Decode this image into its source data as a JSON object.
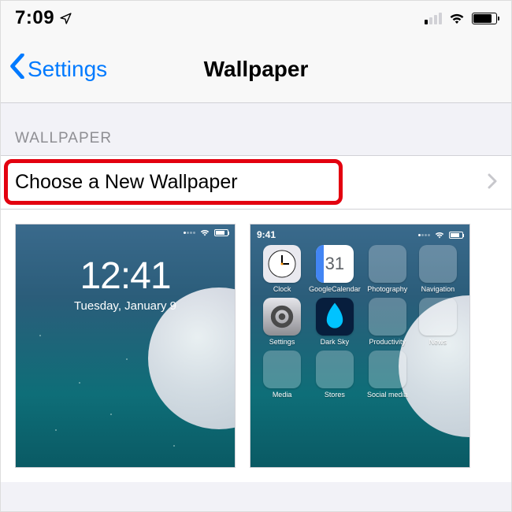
{
  "statusbar": {
    "time": "7:09"
  },
  "nav": {
    "back_label": "Settings",
    "title": "Wallpaper"
  },
  "section": {
    "header": "WALLPAPER",
    "choose_label": "Choose a New Wallpaper"
  },
  "lock_preview": {
    "time": "12:41",
    "date": "Tuesday, January 9"
  },
  "home_preview": {
    "time": "9:41",
    "apps": [
      {
        "name": "Clock"
      },
      {
        "name": "GoogleCalendar",
        "day": "31"
      },
      {
        "name": "Photography",
        "folder": true
      },
      {
        "name": "Navigation",
        "folder": true
      },
      {
        "name": "Settings"
      },
      {
        "name": "Dark Sky"
      },
      {
        "name": "Productivity",
        "folder": true
      },
      {
        "name": "News",
        "folder": true
      },
      {
        "name": "Media",
        "folder": true
      },
      {
        "name": "Stores",
        "folder": true
      },
      {
        "name": "Social media",
        "folder": true
      }
    ]
  }
}
